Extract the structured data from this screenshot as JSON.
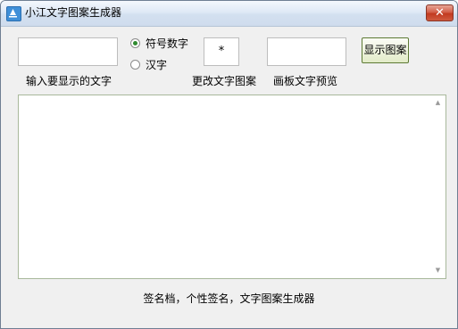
{
  "window": {
    "title": "小江文字图案生成器",
    "close_symbol": "✕"
  },
  "input": {
    "text_value": "",
    "text_label": "输入要显示的文字"
  },
  "radios": [
    {
      "label": "符号数字",
      "checked": true
    },
    {
      "label": "汉字",
      "checked": false
    }
  ],
  "pattern": {
    "value": "*",
    "label": "更改文字图案"
  },
  "preview": {
    "value": "",
    "label": "画板文字预览"
  },
  "buttons": {
    "show_pattern": "显示图案"
  },
  "output": {
    "text": ""
  },
  "footer": {
    "text": "签名档，个性签名，文字图案生成器"
  },
  "colors": {
    "radio_dot": "#2f8a2f",
    "close_button": "#c23a20",
    "button_border": "#5d7a34"
  },
  "icons": {
    "app": "app-icon",
    "close": "close-icon",
    "scroll_up": "scroll-up-arrow-icon",
    "scroll_down": "scroll-down-arrow-icon"
  }
}
